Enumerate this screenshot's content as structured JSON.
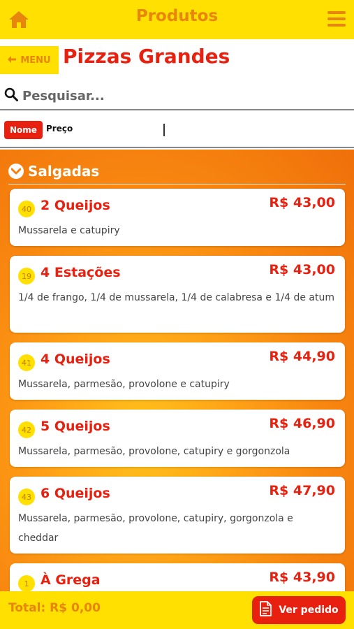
{
  "header": {
    "title": "Produtos",
    "home_icon": "home-icon",
    "menu_icon": "hamburger-icon"
  },
  "menu_button": {
    "label": "MENU",
    "icon": "arrow-left-icon"
  },
  "page_title": "Pizzas Grandes",
  "search": {
    "placeholder": "Pesquisar...",
    "value": ""
  },
  "sort": {
    "nome_label": "Nome",
    "preco_label": "Preço",
    "active": "Nome"
  },
  "category": {
    "name": "Salgadas",
    "icon": "chevron-down-circle-icon"
  },
  "products": [
    {
      "code": "40",
      "name": "2 Queijos",
      "price": "R$ 43,00",
      "description": "Mussarela e catupiry"
    },
    {
      "code": "19",
      "name": "4 Estações",
      "price": "R$ 43,00",
      "description": "1/4 de frango, 1/4 de mussarela, 1/4 de calabresa e 1/4 de atum"
    },
    {
      "code": "41",
      "name": "4 Queijos",
      "price": "R$ 44,90",
      "description": "Mussarela, parmesão, provolone e catupiry"
    },
    {
      "code": "42",
      "name": "5 Queijos",
      "price": "R$ 46,90",
      "description": "Mussarela, parmesão, provolone, catupiry e gorgonzola"
    },
    {
      "code": "43",
      "name": "6 Queijos",
      "price": "R$ 47,90",
      "description": "Mussarela, parmesão, provolone, catupiry, gorgonzola e cheddar"
    },
    {
      "code": "1",
      "name": "À Grega",
      "price": "R$ 43,90",
      "description": ""
    }
  ],
  "footer": {
    "total_label": "Total: R$ 0,00",
    "button_label": "Ver pedido",
    "button_icon": "document-icon"
  },
  "colors": {
    "yellow": "#ffe000",
    "red": "#e8200f",
    "orange": "#e8850c"
  }
}
